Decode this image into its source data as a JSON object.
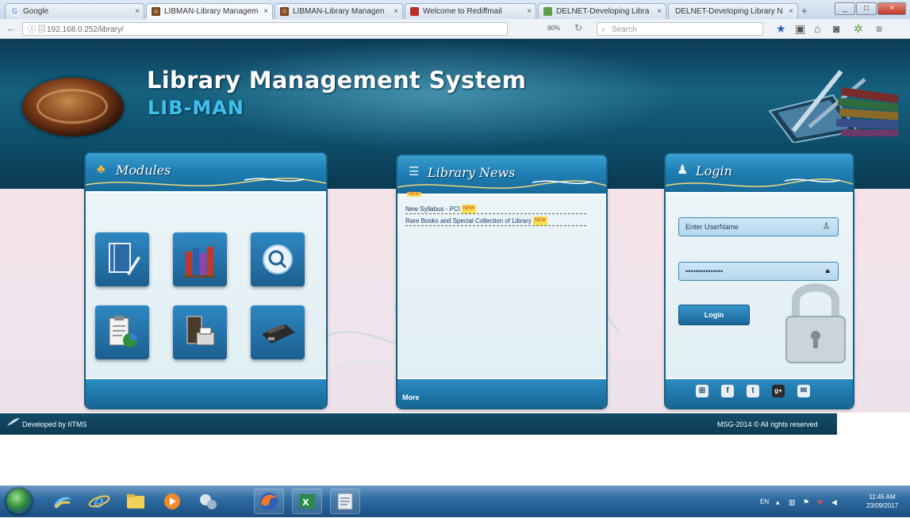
{
  "browser": {
    "tabs": [
      {
        "label": "Google"
      },
      {
        "label": "LIBMAN-Library Managem"
      },
      {
        "label": "LIBMAN-Library Managen"
      },
      {
        "label": "Welcome to Rediffmail"
      },
      {
        "label": "DELNET-Developing Libra"
      },
      {
        "label": "DELNET-Developing Library N"
      }
    ],
    "url": "192.168.0.252/library/",
    "zoom": "90%",
    "search_placeholder": "Search"
  },
  "header": {
    "title": "Library Management System",
    "subtitle": "LIB-MAN"
  },
  "modules": {
    "title": "Modules",
    "icons": [
      "notebook-icon",
      "books-icon",
      "search-icon",
      "clipboard-chart-icon",
      "book-printer-icon",
      "scanner-icon"
    ]
  },
  "news": {
    "title": "Library News",
    "new_tag": "NEW",
    "items": [
      {
        "text": "New Syllabus - PCI"
      },
      {
        "text": "Rare Books and Special Collection of Library"
      }
    ],
    "more_label": "More"
  },
  "login": {
    "title": "Login",
    "username_placeholder": "Enter UserName",
    "password_value": "•••••••••••••••",
    "button_label": "Login",
    "social": [
      "rss-icon",
      "facebook-icon",
      "twitter-icon",
      "googleplus-icon",
      "contact-icon"
    ]
  },
  "footer": {
    "left": "Developed by IITMS",
    "right": "MSG-2014 © All rights reserved"
  },
  "taskbar": {
    "language": "EN",
    "time": "11:45 AM",
    "date": "23/09/2017"
  },
  "colors": {
    "banner": "#0e4d68",
    "panel_header": "#1f7fb4",
    "subtitle": "#3dc0ef"
  }
}
